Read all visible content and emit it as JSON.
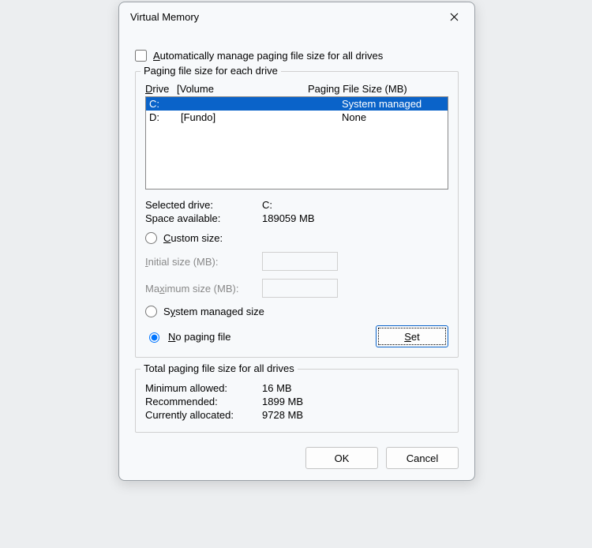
{
  "title": "Virtual Memory",
  "autoManage": {
    "label_pre": "A",
    "label_post": "utomatically manage paging file size for all drives"
  },
  "group1": {
    "legend": "Paging file size for each drive",
    "header_drive_pre": "D",
    "header_drive_post": "rive",
    "header_volume": "[Volume",
    "header_pfs": "Paging File Size (MB)",
    "drives": [
      {
        "letter": "C:",
        "volume": "",
        "pfs": "System managed",
        "selected": true
      },
      {
        "letter": "D:",
        "volume": "[Fundo]",
        "pfs": "None",
        "selected": false
      }
    ],
    "selected_label": "Selected drive:",
    "selected_value": "C:",
    "space_label": "Space available:",
    "space_value": "189059 MB",
    "custom_pre": "C",
    "custom_post": "ustom size:",
    "initial_pre": "I",
    "initial_post": "nitial size (MB):",
    "max_pre": "Ma",
    "max_u": "x",
    "max_post": "imum size (MB):",
    "sysmanaged_pre": "S",
    "sysmanaged_u": "y",
    "sysmanaged_post": "stem managed size",
    "nopaging_pre": "N",
    "nopaging_post": "o paging file",
    "set_btn_pre": "S",
    "set_btn_post": "et"
  },
  "group2": {
    "legend": "Total paging file size for all drives",
    "min_label": "Minimum allowed:",
    "min_value": "16 MB",
    "rec_label": "Recommended:",
    "rec_value": "1899 MB",
    "cur_label": "Currently allocated:",
    "cur_value": "9728 MB"
  },
  "buttons": {
    "ok": "OK",
    "cancel": "Cancel"
  }
}
